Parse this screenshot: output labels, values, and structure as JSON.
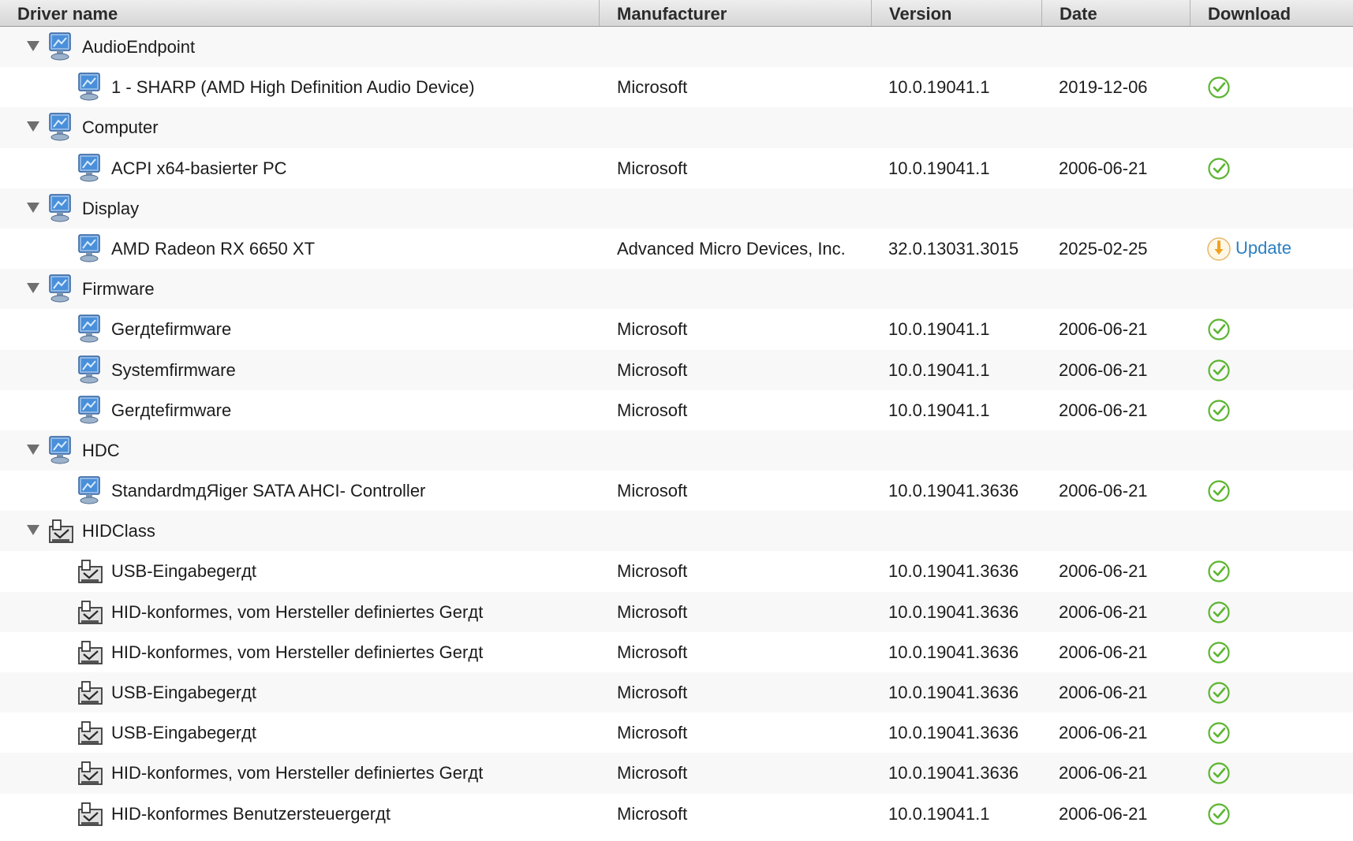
{
  "columns": [
    "Driver name",
    "Manufacturer",
    "Version",
    "Date",
    "Download"
  ],
  "rows": [
    {
      "type": "group",
      "name": "AudioEndpoint",
      "icon": "monitor-icon"
    },
    {
      "type": "item",
      "name": "1 - SHARP (AMD High Definition Audio Device)",
      "icon": "monitor-icon",
      "manufacturer": "Microsoft",
      "version": "10.0.19041.1",
      "date": "2019-12-06",
      "status": "ok"
    },
    {
      "type": "group",
      "name": "Computer",
      "icon": "monitor-icon"
    },
    {
      "type": "item",
      "name": "ACPI x64-basierter PC",
      "icon": "monitor-icon",
      "manufacturer": "Microsoft",
      "version": "10.0.19041.1",
      "date": "2006-06-21",
      "status": "ok"
    },
    {
      "type": "group",
      "name": "Display",
      "icon": "monitor-icon"
    },
    {
      "type": "item",
      "name": "AMD Radeon RX 6650 XT",
      "icon": "monitor-icon",
      "manufacturer": "Advanced Micro Devices, Inc.",
      "version": "32.0.13031.3015",
      "date": "2025-02-25",
      "status": "update",
      "update_label": "Update"
    },
    {
      "type": "group",
      "name": "Firmware",
      "icon": "monitor-icon"
    },
    {
      "type": "item",
      "name": "Gerдtefirmware",
      "icon": "monitor-icon",
      "manufacturer": "Microsoft",
      "version": "10.0.19041.1",
      "date": "2006-06-21",
      "status": "ok"
    },
    {
      "type": "item",
      "name": "Systemfirmware",
      "icon": "monitor-icon",
      "manufacturer": "Microsoft",
      "version": "10.0.19041.1",
      "date": "2006-06-21",
      "status": "ok"
    },
    {
      "type": "item",
      "name": "Gerдtefirmware",
      "icon": "monitor-icon",
      "manufacturer": "Microsoft",
      "version": "10.0.19041.1",
      "date": "2006-06-21",
      "status": "ok"
    },
    {
      "type": "group",
      "name": "HDC",
      "icon": "monitor-icon"
    },
    {
      "type": "item",
      "name": "StandardmдЯiger SATA AHCI- Controller",
      "icon": "monitor-icon",
      "manufacturer": "Microsoft",
      "version": "10.0.19041.3636",
      "date": "2006-06-21",
      "status": "ok"
    },
    {
      "type": "group",
      "name": "HIDClass",
      "icon": "hid-device-icon"
    },
    {
      "type": "item",
      "name": "USB-Eingabegerдt",
      "icon": "hid-device-icon",
      "manufacturer": "Microsoft",
      "version": "10.0.19041.3636",
      "date": "2006-06-21",
      "status": "ok"
    },
    {
      "type": "item",
      "name": "HID-konformes, vom Hersteller definiertes Gerдt",
      "icon": "hid-device-icon",
      "manufacturer": "Microsoft",
      "version": "10.0.19041.3636",
      "date": "2006-06-21",
      "status": "ok"
    },
    {
      "type": "item",
      "name": "HID-konformes, vom Hersteller definiertes Gerдt",
      "icon": "hid-device-icon",
      "manufacturer": "Microsoft",
      "version": "10.0.19041.3636",
      "date": "2006-06-21",
      "status": "ok"
    },
    {
      "type": "item",
      "name": "USB-Eingabegerдt",
      "icon": "hid-device-icon",
      "manufacturer": "Microsoft",
      "version": "10.0.19041.3636",
      "date": "2006-06-21",
      "status": "ok"
    },
    {
      "type": "item",
      "name": "USB-Eingabegerдt",
      "icon": "hid-device-icon",
      "manufacturer": "Microsoft",
      "version": "10.0.19041.3636",
      "date": "2006-06-21",
      "status": "ok"
    },
    {
      "type": "item",
      "name": "HID-konformes, vom Hersteller definiertes Gerдt",
      "icon": "hid-device-icon",
      "manufacturer": "Microsoft",
      "version": "10.0.19041.3636",
      "date": "2006-06-21",
      "status": "ok"
    },
    {
      "type": "item",
      "name": "HID-konformes Benutzersteuergerдt",
      "icon": "hid-device-icon",
      "manufacturer": "Microsoft",
      "version": "10.0.19041.1",
      "date": "2006-06-21",
      "status": "ok"
    }
  ],
  "colors": {
    "ok": "#5cb531",
    "update": "#f0a020",
    "link": "#2a7fc1",
    "header_bg": "#dcdcdc",
    "alt_row": "#f8f8f8"
  }
}
